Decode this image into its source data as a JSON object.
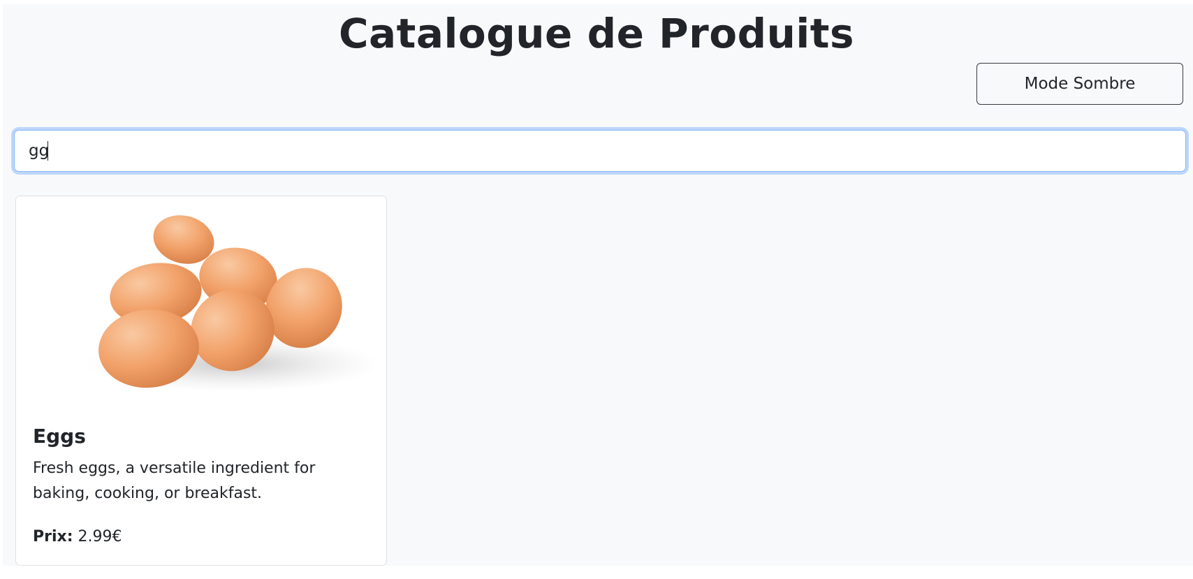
{
  "header": {
    "title": "Catalogue de Produits",
    "mode_button_label": "Mode Sombre"
  },
  "search": {
    "value": "gg",
    "placeholder": ""
  },
  "products": [
    {
      "name": "Eggs",
      "description": "Fresh eggs, a versatile ingredient for baking, cooking, or breakfast.",
      "price_label": "Prix:",
      "price_value": "2.99€",
      "image": "eggs-photo"
    }
  ],
  "colors": {
    "page_background": "#f8f9fa",
    "text": "#212529",
    "focus_border": "#86b7fe",
    "card_border": "#dee2e6",
    "egg": "#f2a26a"
  }
}
